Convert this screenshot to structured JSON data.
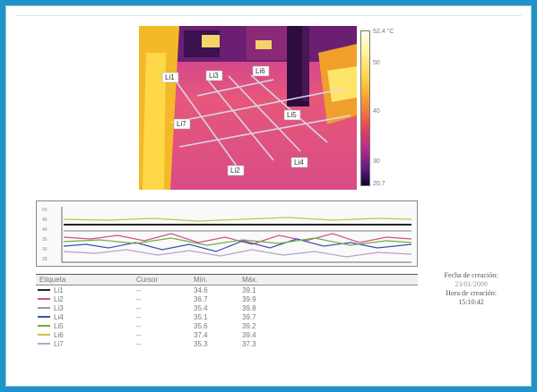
{
  "thermal": {
    "colorbar_labels": [
      "52,4 °C",
      "50",
      "40",
      "30",
      "20,7"
    ],
    "lines": [
      {
        "id": "Li1",
        "label": "Li1"
      },
      {
        "id": "Li3",
        "label": "Li3"
      },
      {
        "id": "Li6",
        "label": "Li6"
      },
      {
        "id": "Li7",
        "label": "Li7"
      },
      {
        "id": "Li5",
        "label": "Li5"
      },
      {
        "id": "Li2",
        "label": "Li2"
      },
      {
        "id": "Li4",
        "label": "Li4"
      }
    ]
  },
  "profile_chart": {
    "y_ticks": [
      "50",
      "45",
      "40",
      "35",
      "30",
      "25"
    ]
  },
  "table": {
    "headers": {
      "tag": "Etiqueta",
      "cursor": "Cursor",
      "min": "Mín.",
      "max": "Máx."
    },
    "rows": [
      {
        "tag": "Li1",
        "cursor": "--",
        "min": "34.6",
        "max": "39.1",
        "color": "#222222"
      },
      {
        "tag": "Li2",
        "cursor": "--",
        "min": "36.7",
        "max": "39.9",
        "color": "#d54d8f"
      },
      {
        "tag": "Li3",
        "cursor": "--",
        "min": "35.4",
        "max": "39.8",
        "color": "#9a9a9a"
      },
      {
        "tag": "Li4",
        "cursor": "--",
        "min": "35.1",
        "max": "39.7",
        "color": "#3f4fb0"
      },
      {
        "tag": "Li5",
        "cursor": "--",
        "min": "35.6",
        "max": "39.2",
        "color": "#6cb03c"
      },
      {
        "tag": "Li6",
        "cursor": "--",
        "min": "37.4",
        "max": "39.4",
        "color": "#c7c34a"
      },
      {
        "tag": "Li7",
        "cursor": "--",
        "min": "35.3",
        "max": "37.3",
        "color": "#b9a2c9"
      }
    ]
  },
  "capture": {
    "date_label": "Fecha de creación:",
    "date_value": "23/01/2009",
    "time_label": "Hora de creación:",
    "time_value": "15:10:42"
  }
}
